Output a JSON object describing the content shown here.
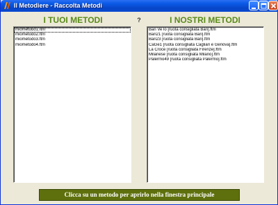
{
  "window": {
    "title": "Il Metodiere - Raccolta Metodi",
    "icons": {
      "app": "metodiere-app-icon",
      "minimize": "minimize-icon",
      "maximize": "maximize-icon",
      "close": "close-icon"
    }
  },
  "left_panel": {
    "heading": "I TUOI METODI",
    "items": [
      "miometodo1.ftm",
      "miometodo2.ftm",
      "miometodo3.ftm",
      "miometodo4.ftm"
    ]
  },
  "help": {
    "label": "?"
  },
  "right_panel": {
    "heading": "I NOSTRI METODI",
    "items": [
      "Bari VeTo [ruota consigliata Bari].ftm",
      "Bari21 [ruota consigliata Bari].ftm",
      "Bari23 [ruota consigliata Bari].ftm",
      "CaGe1 [ruota consigliata Cagliari e Genova].ftm",
      "La Croce [ruota consigliata Firenze].ftm",
      "Milanese [ruota consigliata Milano].ftm",
      "Palermo49 [ruota consigliata Palermo].ftm"
    ]
  },
  "status": {
    "text": "Clicca su un metodo per aprirlo nella finestra principale"
  },
  "colors": {
    "heading": "#5a8a1a",
    "status_bg": "#5e700d",
    "titlebar": "#0a5ae6"
  }
}
